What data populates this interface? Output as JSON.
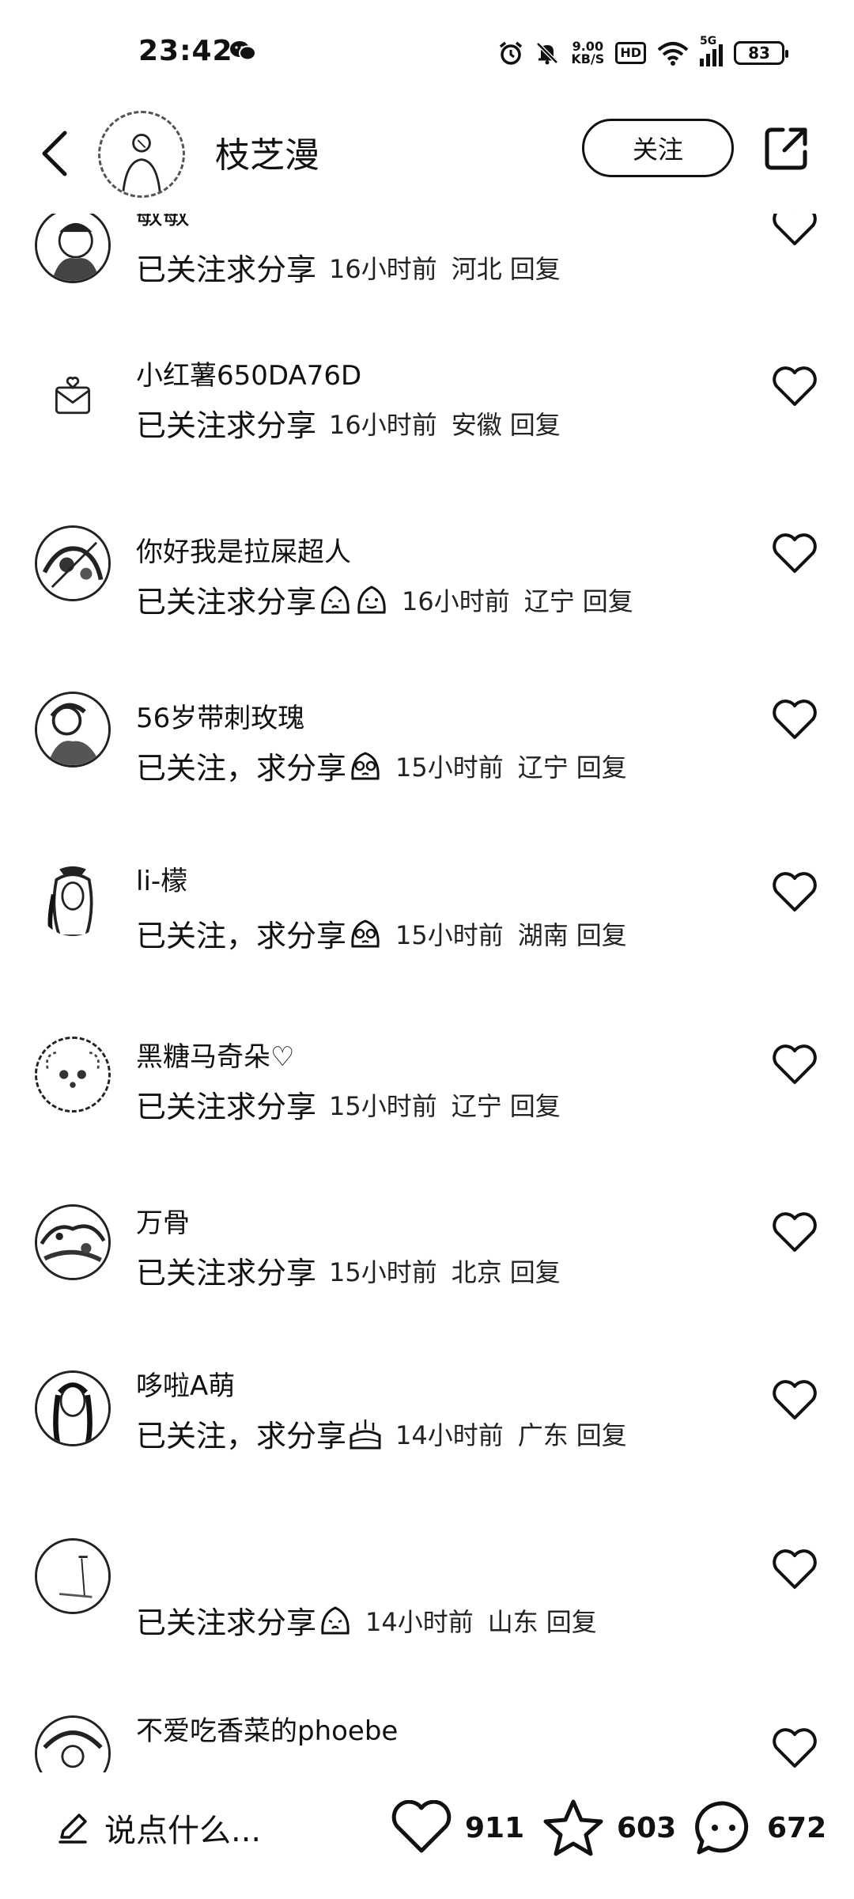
{
  "status_bar": {
    "time": "23:42",
    "left_icon": "wechat-icon",
    "speed_value": "9.00",
    "speed_unit": "KB/S",
    "hd_label": "HD",
    "network": "5G",
    "battery": "83"
  },
  "header": {
    "author_name": "枝芝漫",
    "follow_label": "关注"
  },
  "comments": [
    {
      "name": "敏敏",
      "text": "已关注求分享",
      "emojis": [],
      "time": "16小时前",
      "location": "河北",
      "reply": "回复"
    },
    {
      "name": "小红薯650DA76D",
      "text": "已关注求分享",
      "emojis": [],
      "time": "16小时前",
      "location": "安徽",
      "reply": "回复"
    },
    {
      "name": "你好我是拉屎超人",
      "text": "已关注求分享",
      "emojis": [
        "sad-face",
        "smile-face"
      ],
      "time": "16小时前",
      "location": "辽宁",
      "reply": "回复"
    },
    {
      "name": "56岁带刺玫瑰",
      "text": "已关注，求分享",
      "emojis": [
        "pleading-face"
      ],
      "time": "15小时前",
      "location": "辽宁",
      "reply": "回复"
    },
    {
      "name": "li-檬",
      "text": "已关注，求分享",
      "emojis": [
        "pleading-face"
      ],
      "time": "15小时前",
      "location": "湖南",
      "reply": "回复"
    },
    {
      "name": "黑糖马奇朵♡",
      "text": "已关注求分享",
      "emojis": [],
      "time": "15小时前",
      "location": "辽宁",
      "reply": "回复"
    },
    {
      "name": "万骨",
      "text": "已关注求分享",
      "emojis": [],
      "time": "15小时前",
      "location": "北京",
      "reply": "回复"
    },
    {
      "name": "哆啦A萌",
      "text": "已关注，求分享",
      "emojis": [
        "cake"
      ],
      "time": "14小时前",
      "location": "广东",
      "reply": "回复"
    },
    {
      "name": "",
      "text": "已关注求分享",
      "emojis": [
        "sad-face"
      ],
      "time": "14小时前",
      "location": "山东",
      "reply": "回复"
    },
    {
      "name": "不爱吃香菜的phoebe",
      "text": "",
      "emojis": [],
      "time": "",
      "location": "",
      "reply": ""
    }
  ],
  "bottom_bar": {
    "input_placeholder": "说点什么...",
    "likes": "911",
    "favorites": "603",
    "comments": "672"
  }
}
